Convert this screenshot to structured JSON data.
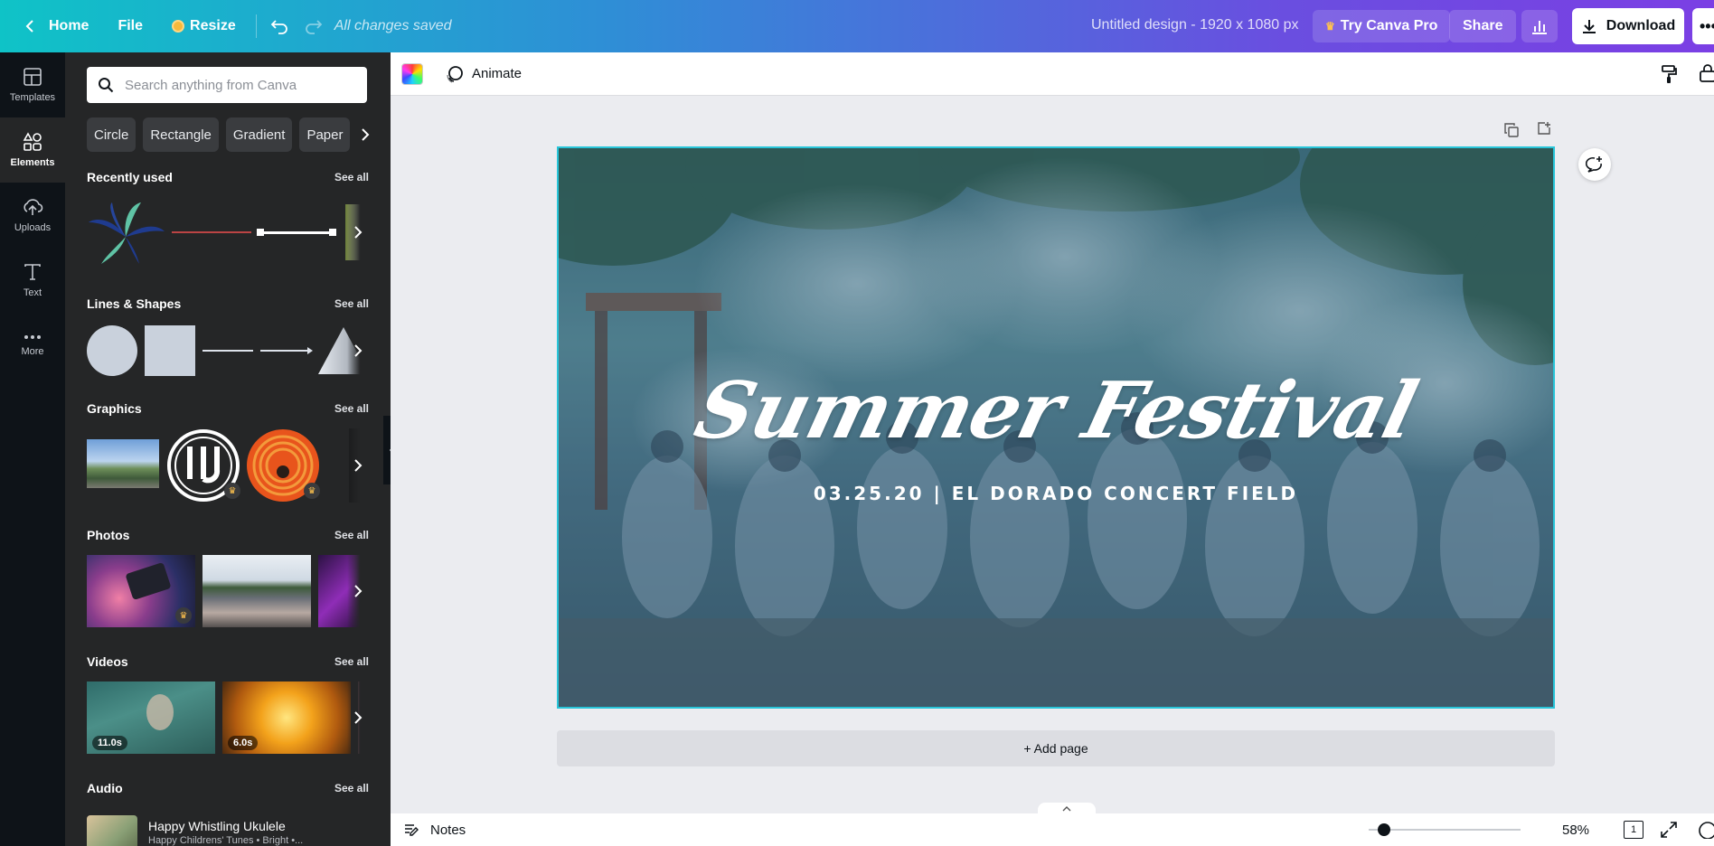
{
  "topbar": {
    "home_label": "Home",
    "file_label": "File",
    "resize_label": "Resize",
    "saved_status": "All changes saved",
    "design_title": "Untitled design - 1920 x 1080 px",
    "pro_label": "Try Canva Pro",
    "share_label": "Share",
    "download_label": "Download"
  },
  "rail": {
    "items": [
      {
        "label": "Templates",
        "icon": "templates-icon"
      },
      {
        "label": "Elements",
        "icon": "elements-icon"
      },
      {
        "label": "Uploads",
        "icon": "uploads-icon"
      },
      {
        "label": "Text",
        "icon": "text-icon"
      },
      {
        "label": "More",
        "icon": "more-icon"
      }
    ],
    "active": "Elements"
  },
  "panel": {
    "search_placeholder": "Search anything from Canva",
    "chips": [
      "Circle",
      "Rectangle",
      "Gradient",
      "Paper"
    ],
    "see_all": "See all",
    "sections": {
      "recent": "Recently used",
      "lines": "Lines & Shapes",
      "graphics": "Graphics",
      "photos": "Photos",
      "videos": "Videos",
      "audio": "Audio"
    },
    "videos": [
      {
        "duration": "11.0s"
      },
      {
        "duration": "6.0s"
      }
    ],
    "audio": {
      "track_title": "Happy Whistling Ukulele",
      "track_subtitle": "Happy Childrens' Tunes • Bright •..."
    }
  },
  "editor": {
    "animate_label": "Animate",
    "headline": "Summer Festival",
    "subline": "03.25.20 | EL DORADO CONCERT FIELD",
    "add_page_label": "+ Add page",
    "notes_label": "Notes",
    "zoom": "58%",
    "page_count": "1",
    "zoom_fraction": 0.1
  },
  "colors": {
    "accent": "#27c5d9",
    "topbar_start": "#0fc3c7",
    "topbar_end": "#7b3fe4",
    "panel_bg": "#252627",
    "rail_bg": "#0e1318"
  }
}
